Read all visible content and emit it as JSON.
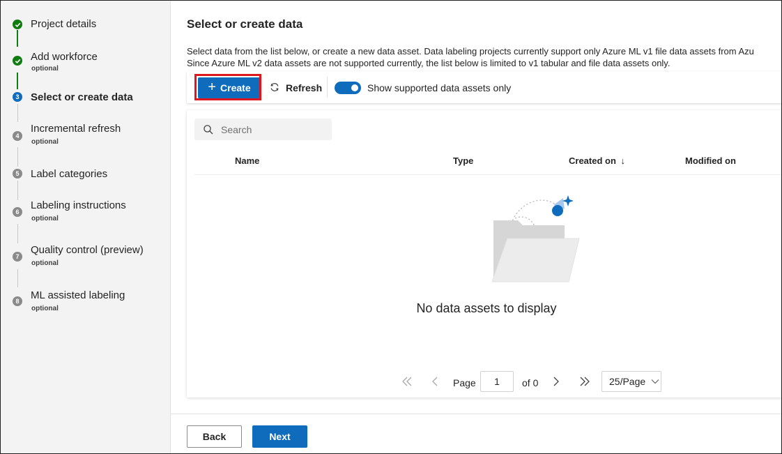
{
  "wizard": {
    "steps": [
      {
        "number": "",
        "label": "Project details",
        "optional": "",
        "status": "completed"
      },
      {
        "number": "",
        "label": "Add workforce",
        "optional": "optional",
        "status": "completed"
      },
      {
        "number": "3",
        "label": "Select or create data",
        "optional": "",
        "status": "current"
      },
      {
        "number": "4",
        "label": "Incremental refresh",
        "optional": "optional",
        "status": "pending"
      },
      {
        "number": "5",
        "label": "Label categories",
        "optional": "",
        "status": "pending"
      },
      {
        "number": "6",
        "label": "Labeling instructions",
        "optional": "optional",
        "status": "pending"
      },
      {
        "number": "7",
        "label": "Quality control (preview)",
        "optional": "optional",
        "status": "pending"
      },
      {
        "number": "8",
        "label": "ML assisted labeling",
        "optional": "optional",
        "status": "pending"
      }
    ]
  },
  "main": {
    "title": "Select or create data",
    "description_line1": "Select data from the list below, or create a new data asset. Data labeling projects currently support only Azure ML v1 file data assets from Azu",
    "description_line2": "Since Azure ML v2 data assets are not supported currently, the list below is limited to v1 tabular and file data assets only."
  },
  "toolbar": {
    "create_label": "Create",
    "refresh_label": "Refresh",
    "toggle_label": "Show supported data assets only",
    "toggle_on": true
  },
  "table": {
    "search_placeholder": "Search",
    "columns": {
      "name": "Name",
      "type": "Type",
      "created_on": "Created on",
      "created_sort": "↓",
      "modified_on": "Modified on"
    },
    "empty_message": "No data assets to display"
  },
  "pagination": {
    "page_label": "Page",
    "page_value": "1",
    "of_label": "of 0",
    "page_size": "25/Page"
  },
  "footer": {
    "back_label": "Back",
    "next_label": "Next"
  },
  "colors": {
    "accent": "#0f6cbd",
    "completed": "#107c10",
    "highlight": "#e0161e"
  }
}
